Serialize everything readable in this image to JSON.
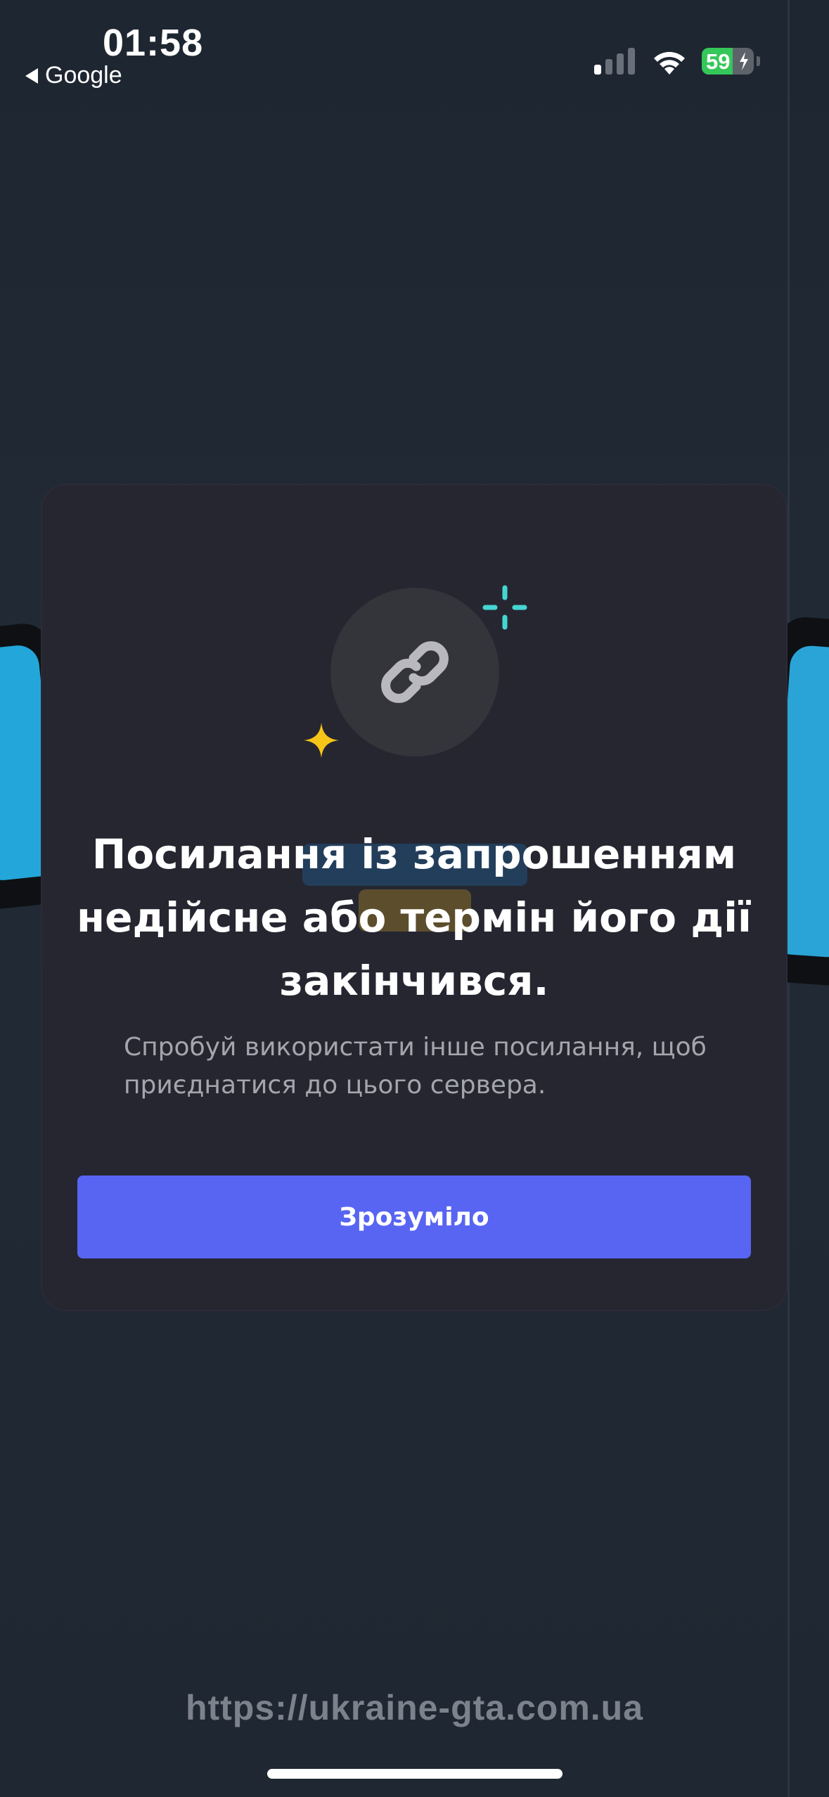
{
  "status_bar": {
    "time": "01:58",
    "back_app": "Google",
    "battery_percent": "59",
    "battery_level": 0.59,
    "signal_bars_active": 1,
    "signal_bars_total": 4
  },
  "modal": {
    "icon": "link-icon",
    "title": "Посилання із запрошенням недійсне або термін його дії закінчився.",
    "subtitle": "Спробуй використати інше посилання, щоб приєднатися до цього сервера.",
    "button_label": "Зрозуміло"
  },
  "watermark": {
    "url": "https://ukraine-gta.com.ua"
  },
  "colors": {
    "background": "#1f2630",
    "card": "#262631",
    "icon_circle": "#34343b",
    "primary_button": "#5865f2",
    "sparkle_teal": "#45d6d2",
    "sparkle_yellow": "#f5c518",
    "battery_green": "#34c759"
  }
}
